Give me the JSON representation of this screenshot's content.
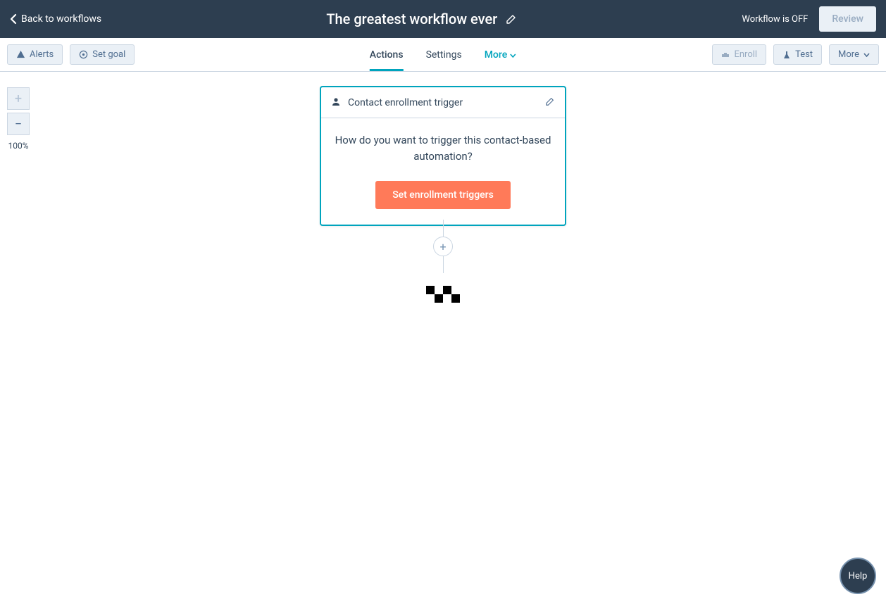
{
  "header": {
    "back_label": "Back to workflows",
    "title": "The greatest workflow ever",
    "status": "Workflow is OFF",
    "review_label": "Review"
  },
  "toolbar": {
    "alerts_label": "Alerts",
    "goal_label": "Set goal",
    "tabs": {
      "actions": "Actions",
      "settings": "Settings",
      "more": "More"
    },
    "enroll_label": "Enroll",
    "test_label": "Test",
    "more_label": "More"
  },
  "zoom": {
    "percent": "100%"
  },
  "trigger": {
    "title": "Contact enrollment trigger",
    "question": "How do you want to trigger this contact-based automation?",
    "cta": "Set enrollment triggers"
  },
  "add_button": "+",
  "help": {
    "label": "Help"
  }
}
